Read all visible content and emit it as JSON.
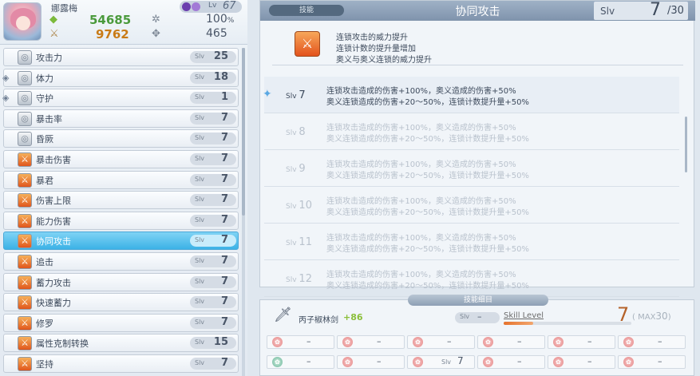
{
  "character": {
    "name": "娜露梅",
    "lv_label": "Lv",
    "level": "67",
    "hp": "54685",
    "atk": "9762",
    "stat_pct": "100",
    "pct_unit": "%",
    "stat_2": "465"
  },
  "skills": [
    {
      "label": "攻击力",
      "slv_label": "Slv",
      "value": "25",
      "icon": "sword-icon",
      "style": "grey",
      "side": false
    },
    {
      "label": "体力",
      "slv_label": "Slv",
      "value": "18",
      "icon": "heart-icon",
      "style": "grey",
      "side": true
    },
    {
      "label": "守护",
      "slv_label": "Slv",
      "value": "1",
      "icon": "shield-heart-icon",
      "style": "grey",
      "side": true
    },
    {
      "label": "暴击率",
      "slv_label": "Slv",
      "value": "7",
      "icon": "critical-icon",
      "style": "grey",
      "side": false
    },
    {
      "label": "昏厥",
      "slv_label": "Slv",
      "value": "7",
      "icon": "stun-icon",
      "style": "grey",
      "side": false
    },
    {
      "label": "暴击伤害",
      "slv_label": "Slv",
      "value": "7",
      "icon": "sword-orange-icon",
      "style": "orange",
      "side": false
    },
    {
      "label": "暴君",
      "slv_label": "Slv",
      "value": "7",
      "icon": "sword-orange-icon",
      "style": "orange",
      "side": false
    },
    {
      "label": "伤害上限",
      "slv_label": "Slv",
      "value": "7",
      "icon": "sword-orange-icon",
      "style": "orange",
      "side": false
    },
    {
      "label": "能力伤害",
      "slv_label": "Slv",
      "value": "7",
      "icon": "sword-orange-icon",
      "style": "orange",
      "side": false
    },
    {
      "label": "协同攻击",
      "slv_label": "Slv",
      "value": "7",
      "icon": "sword-orange-icon",
      "style": "orange",
      "side": false,
      "selected": true
    },
    {
      "label": "追击",
      "slv_label": "Slv",
      "value": "7",
      "icon": "sword-orange-icon",
      "style": "orange",
      "side": false
    },
    {
      "label": "蓄力攻击",
      "slv_label": "Slv",
      "value": "7",
      "icon": "sword-orange-icon",
      "style": "orange",
      "side": false
    },
    {
      "label": "快速蓄力",
      "slv_label": "Slv",
      "value": "7",
      "icon": "sword-orange-icon",
      "style": "orange",
      "side": false
    },
    {
      "label": "修罗",
      "slv_label": "Slv",
      "value": "7",
      "icon": "sword-orange-icon",
      "style": "orange",
      "side": false
    },
    {
      "label": "属性克制转换",
      "slv_label": "Slv",
      "value": "15",
      "icon": "sword-orange-icon",
      "style": "orange",
      "side": false
    },
    {
      "label": "坚持",
      "slv_label": "Slv",
      "value": "7",
      "icon": "sword-orange-icon",
      "style": "orange",
      "side": false
    }
  ],
  "detail": {
    "tag": "技能",
    "title": "协同攻击",
    "slv_label": "Slv",
    "slv_current": "7",
    "slv_max": "/30",
    "description": [
      "连锁攻击的威力提升",
      "连锁计数的提升量增加",
      "奥义与奥义连锁的威力提升"
    ],
    "levels": [
      {
        "slv": "Slv",
        "num": "7",
        "line1": "连锁攻击造成的伤害+100%，奥义造成的伤害+50%",
        "line2": "奥义连锁造成的伤害+20～50%，连锁计数提升量+50%",
        "current": true
      },
      {
        "slv": "Slv",
        "num": "8",
        "line1": "连锁攻击造成的伤害+100%，奥义造成的伤害+50%",
        "line2": "奥义连锁造成的伤害+20～50%，连锁计数提升量+50%"
      },
      {
        "slv": "Slv",
        "num": "9",
        "line1": "连锁攻击造成的伤害+100%，奥义造成的伤害+50%",
        "line2": "奥义连锁造成的伤害+20～50%，连锁计数提升量+50%"
      },
      {
        "slv": "Slv",
        "num": "10",
        "line1": "连锁攻击造成的伤害+100%，奥义造成的伤害+50%",
        "line2": "奥义连锁造成的伤害+20～50%，连锁计数提升量+50%"
      },
      {
        "slv": "Slv",
        "num": "11",
        "line1": "连锁攻击造成的伤害+100%，奥义造成的伤害+50%",
        "line2": "奥义连锁造成的伤害+20～50%，连锁计数提升量+50%"
      },
      {
        "slv": "Slv",
        "num": "12",
        "line1": "连锁攻击造成的伤害+100%，奥义造成的伤害+50%",
        "line2": "奥义连锁造成的伤害+20～50%，连锁计数提升量+50%"
      }
    ]
  },
  "breakdown": {
    "header": "技能细目",
    "weapon_name": "丙子椒林剑",
    "weapon_plus": "+86",
    "weapon_slv_label": "Slv",
    "weapon_slv": "–",
    "skill_level_label": "Skill Level",
    "skill_level_fill": 0.23,
    "skill_level": "7",
    "max_label": "MAX",
    "max_value": "30",
    "slots_row1": [
      "–",
      "–",
      "–",
      "–",
      "–",
      "–"
    ],
    "slots_row2": [
      "–",
      "–",
      "7",
      "–",
      "–",
      "–"
    ],
    "slot2_label": "Slv"
  },
  "colors": {
    "accent": "#3cb2e6",
    "orange": "#e3531d",
    "hp": "#4a9a3c",
    "atk": "#c97b17"
  }
}
